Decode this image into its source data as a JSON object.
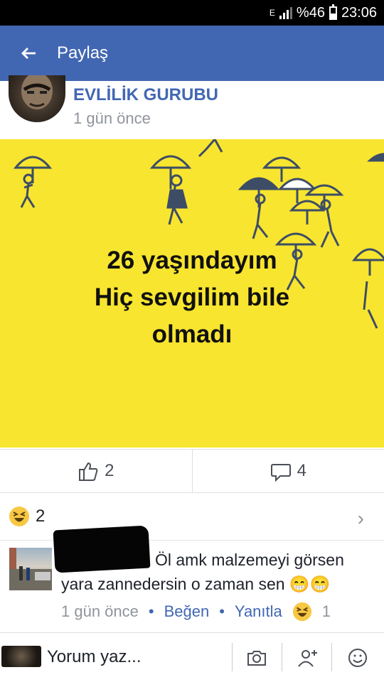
{
  "status": {
    "carrier_glyph": "E",
    "battery_text": "%46",
    "battery_level": 0.46,
    "time": "23:06"
  },
  "appbar": {
    "back_icon": "arrow-left-icon",
    "title": "Paylaş"
  },
  "post": {
    "group_name": "EVLİLİK GURUBU",
    "time": "1 gün önce",
    "image_text": [
      "26 yaşındayım",
      "Hiç sevgilim bile",
      "olmadı"
    ],
    "image_bg": "#f8e52f"
  },
  "counts": {
    "likes": "2",
    "comments": "4"
  },
  "reactions": {
    "haha_count": "2"
  },
  "comment": {
    "line1": "Öl amk malzemeyi görsen",
    "line2": "yara zannedersin o zaman sen 😁😁",
    "time": "1 gün önce",
    "like_label": "Beğen",
    "reply_label": "Yanıtla",
    "haha_count": "1"
  },
  "composer": {
    "placeholder": "Yorum yaz..."
  },
  "colors": {
    "brand": "#4267b2",
    "muted": "#90949c"
  }
}
